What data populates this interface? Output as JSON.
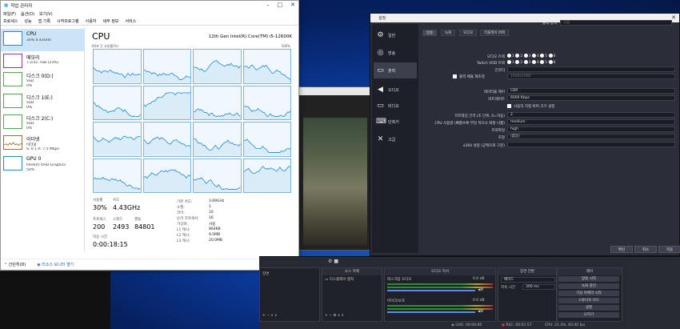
{
  "taskmgr": {
    "title": "작업 관리자",
    "menu": [
      "파일(F)",
      "옵션(O)",
      "보기(V)"
    ],
    "tabs": [
      "프로세스",
      "성능",
      "앱 기록",
      "시작프로그램",
      "사용자",
      "세부 정보",
      "서비스"
    ],
    "sidebar": [
      {
        "name": "CPU",
        "sub": "30%  4.43GHz",
        "color": "#1a8ad2"
      },
      {
        "name": "메모리",
        "sub": "7.2/31.7GB (23%)",
        "color": "#9b2fae"
      },
      {
        "name": "디스크 0(D:)",
        "sub": "SSD",
        "sub2": "0%",
        "color": "#4da84d"
      },
      {
        "name": "디스크 1(E:)",
        "sub": "SSD",
        "sub2": "0%",
        "color": "#4da84d"
      },
      {
        "name": "디스크 2(C:)",
        "sub": "SSD",
        "sub2": "0%",
        "color": "#4da84d"
      },
      {
        "name": "이더넷",
        "sub": "이더넷",
        "sub2": "S: 0.1 R: 7.5 Mbps",
        "color": "#a86b2a"
      },
      {
        "name": "GPU 0",
        "sub": "Intel(R) UHD Graphics",
        "sub2": "50%",
        "color": "#1a8ad2"
      }
    ],
    "cpu": {
      "heading": "CPU",
      "model": "12th Gen Intel(R) Core(TM) i5-12600K",
      "graph_caption_left": "60초 간 사용률(%)",
      "graph_caption_right": "100%",
      "labels": {
        "usage": "사용률",
        "speed": "속도",
        "processes": "프로세스",
        "threads": "스레드",
        "handles": "핸들",
        "uptime": "작동 시간"
      },
      "usage": "30%",
      "speed": "4.43GHz",
      "processes": "200",
      "threads": "2493",
      "handles": "84801",
      "uptime": "0:00:18:15",
      "specs": [
        {
          "k": "기본 속도:",
          "v": "3.69GHz"
        },
        {
          "k": "소켓:",
          "v": "1"
        },
        {
          "k": "코어:",
          "v": "10"
        },
        {
          "k": "논리 프로세서:",
          "v": "16"
        },
        {
          "k": "가상화:",
          "v": "사용"
        },
        {
          "k": "L1 캐시:",
          "v": "864KB"
        },
        {
          "k": "L2 캐시:",
          "v": "9.5MB"
        },
        {
          "k": "L3 캐시:",
          "v": "20.0MB"
        }
      ]
    },
    "footer": {
      "collapse": "간단히(D)",
      "resource_monitor": "리소스 모니터 열기"
    }
  },
  "settings": {
    "title": "설정",
    "nav": [
      {
        "label": "일반",
        "icon": "gear-icon"
      },
      {
        "label": "방송",
        "icon": "broadcast-icon"
      },
      {
        "label": "출력",
        "icon": "output-icon"
      },
      {
        "label": "오디오",
        "icon": "speaker-icon"
      },
      {
        "label": "비디오",
        "icon": "monitor-icon"
      },
      {
        "label": "단축키",
        "icon": "keyboard-icon"
      },
      {
        "label": "고급",
        "icon": "tools-icon"
      }
    ],
    "output_mode_label": "출력 방식",
    "output_mode_value": "고급",
    "subtabs": [
      "방송",
      "녹화",
      "오디오",
      "리플레이 버퍼"
    ],
    "audio_track_label": "오디오 트랙",
    "twitch_vod_label": "Twitch VOD 트랙",
    "tracks": [
      "1",
      "2",
      "3",
      "4",
      "5",
      "6"
    ],
    "encoder_label": "인코더",
    "rescale_label": "출력 배율 재조정",
    "rescale_value": "1920x1080",
    "rate_control_label": "데이터율 제어",
    "rate_control_value": "CBR",
    "bitrate_label": "비트레이트",
    "bitrate_value": "6000 Kbps",
    "custom_buffer_label": "사용자 지정 버퍼 크기 설정",
    "keyframe_label": "키프레임 간격 (초 단위, 0=자동)",
    "keyframe_value": "2",
    "preset_label": "CPU 사용량 (빠를수록 부담 적으나 화질 나쁨)",
    "preset_value": "medium",
    "profile_label": "프로파일",
    "profile_value": "high",
    "tune_label": "조정",
    "tune_value": "(없음)",
    "x264_label": "x264 설정 (공백으로 구분)",
    "buttons": {
      "ok": "확인",
      "cancel": "취소",
      "apply": "적용"
    }
  },
  "obs": {
    "scenes_label": "장면",
    "sources_title": "소스 목록",
    "source_item": "디스플레이 캡처",
    "mixer_title": "오디오 믹서",
    "mixer_tracks": [
      {
        "name": "데스크탑 오디오",
        "db": "0.0 dB"
      },
      {
        "name": "마이크/보조",
        "db": "0.0 dB"
      }
    ],
    "transitions_title": "장면 전환",
    "transition_type": "페이드",
    "duration_label": "지속 시간",
    "duration_value": "300 ms",
    "controls_title": "제어",
    "controls": [
      "방송 시작",
      "녹화 중단",
      "가상 카메라 시작",
      "스튜디오 모드",
      "설정",
      "나가기"
    ],
    "status": {
      "live": "LIVE: 00:00:00",
      "rec": "REC: 00:01:57",
      "cpu": "CPU: 21.4%, 60.00 fps"
    }
  }
}
